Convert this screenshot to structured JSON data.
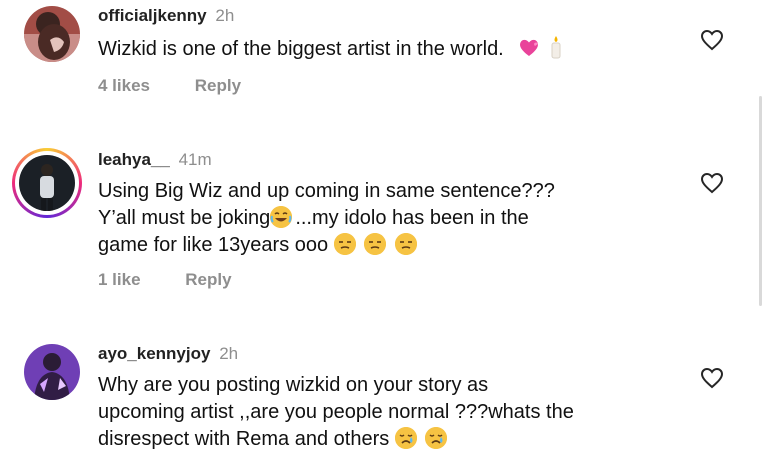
{
  "comments": [
    {
      "username": "officialjkenny",
      "time": "2h",
      "text": "Wizkid is one of the biggest artist in the world.",
      "likes": "4 likes",
      "reply": "Reply",
      "emoji": [
        "heart-icon",
        "candle-icon"
      ]
    },
    {
      "username": "leahya__",
      "time": "41m",
      "text_lines": [
        "Using Big Wiz and up coming in same sentence???",
        "Y’all must be joking",
        "...my idolo has been in the",
        "game for like 13years ooo"
      ],
      "likes": "1 like",
      "reply": "Reply"
    },
    {
      "username": "ayo_kennyjoy",
      "time": "2h",
      "text_lines": [
        "Why are you posting wizkid on your story as",
        "upcoming artist ,,are you people normal ???whats the",
        "disrespect with Rema and others"
      ]
    }
  ]
}
